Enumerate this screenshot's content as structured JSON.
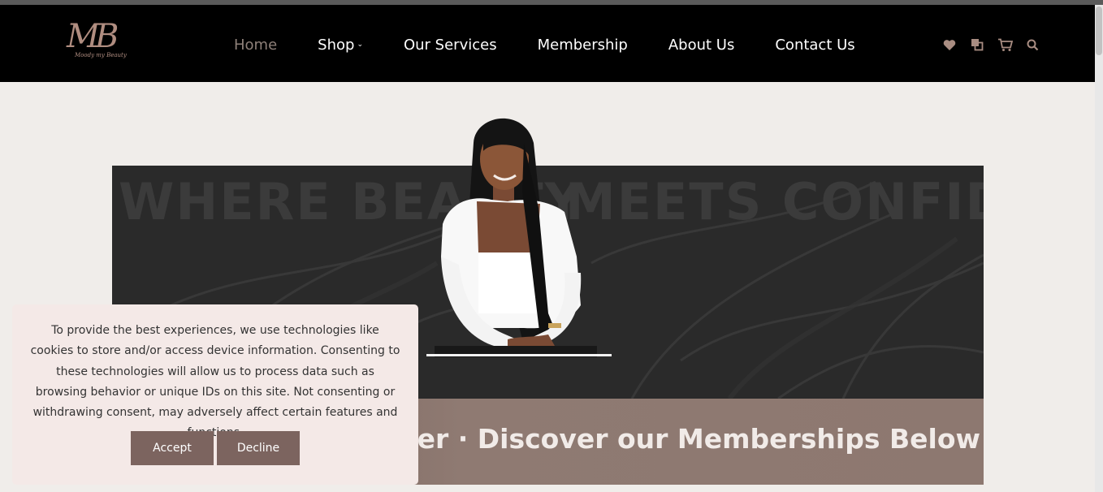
{
  "brand": {
    "logo_monogram": "MB",
    "logo_tagline": "Moody my Beauty"
  },
  "nav": {
    "items": [
      {
        "label": "Home",
        "active": true
      },
      {
        "label": "Shop",
        "dropdown": true
      },
      {
        "label": "Our Services"
      },
      {
        "label": "Membership"
      },
      {
        "label": "About Us"
      },
      {
        "label": "Contact Us"
      }
    ],
    "dropdown_icon": "chevron-down-icon"
  },
  "header_icons": [
    "heart-icon",
    "compare-icon",
    "cart-icon",
    "search-icon"
  ],
  "hero": {
    "headline_left": "WHERE BEAUTY",
    "headline_right": "MEETS CONFIDENCE",
    "marquee": "mber · Discover our Memberships Below"
  },
  "cookie": {
    "message": "To provide the best experiences, we use technologies like cookies to store and/or access device information. Consenting to these technologies will allow us to process data such as browsing behavior or unique IDs on this site. Not consenting or withdrawing consent, may adversely affect certain features and functions.",
    "accept_label": "Accept",
    "decline_label": "Decline"
  },
  "colors": {
    "header_bg": "#000000",
    "accent": "#a98d82",
    "active_nav": "#8e8079",
    "button": "#7c645f",
    "page_bg": "#f0edea",
    "cookie_bg": "#f4e9e7"
  }
}
